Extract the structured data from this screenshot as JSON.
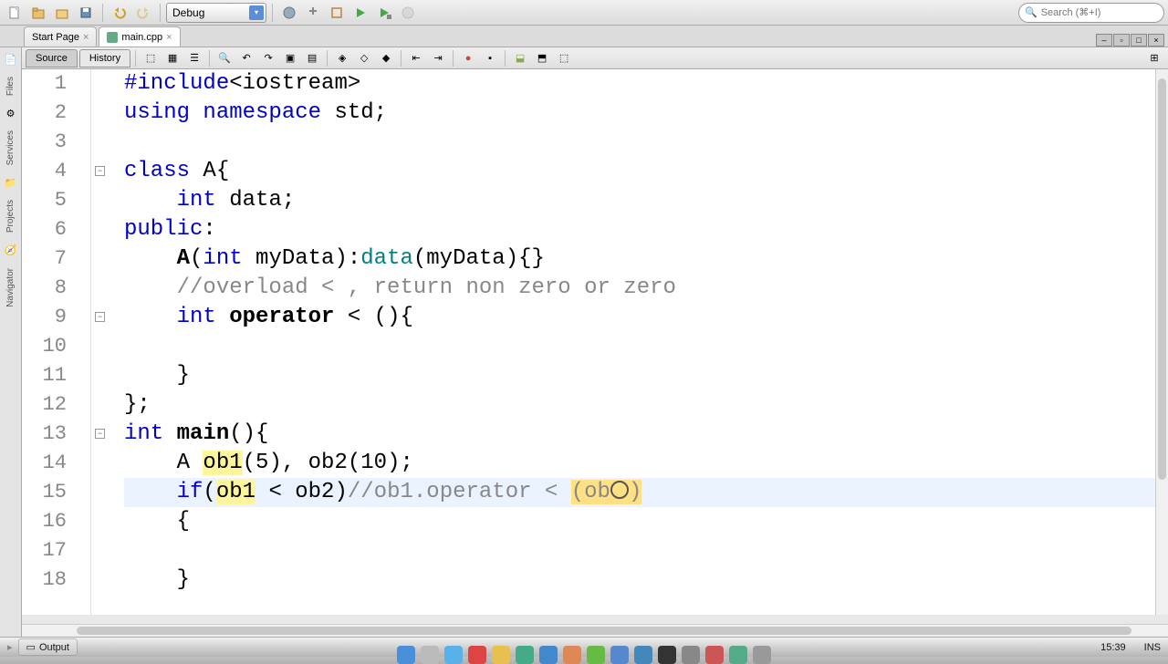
{
  "toolbar": {
    "config": "Debug",
    "search_placeholder": "Search (⌘+I)"
  },
  "tabs": {
    "start_page": "Start Page",
    "main_cpp": "main.cpp"
  },
  "editor_tabs": {
    "source": "Source",
    "history": "History"
  },
  "rail": {
    "files": "Files",
    "services": "Services",
    "projects": "Projects",
    "navigator": "Navigator"
  },
  "code": {
    "lines": [
      "#include<iostream>",
      "using namespace std;",
      "",
      "class A{",
      "    int data;",
      "public:",
      "    A(int myData):data(myData){}",
      "    //overload < , return non zero or zero",
      "    int operator < (){",
      "",
      "    }",
      "};",
      "int main(){",
      "    A ob1(5), ob2(10);",
      "    if(ob1 < ob2)//ob1.operator < (ob2)",
      "    {",
      "",
      "    }"
    ],
    "line_count": 18,
    "current_line": 15
  },
  "status": {
    "output": "Output",
    "cursor": "15:39",
    "mode": "INS"
  },
  "chart_data": null
}
